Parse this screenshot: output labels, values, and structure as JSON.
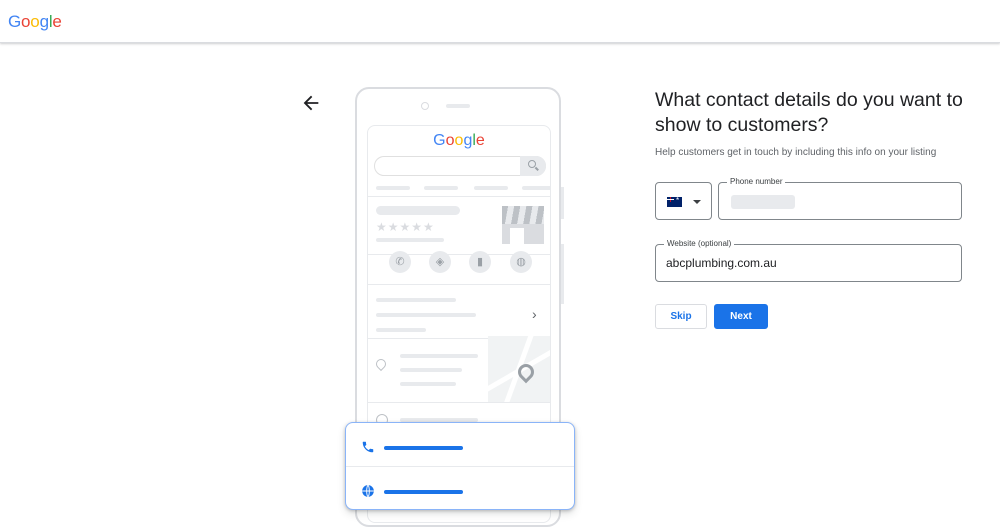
{
  "header": {
    "logo_text": "Google",
    "logo_letters": [
      {
        "ch": "G",
        "color": "#4285f4"
      },
      {
        "ch": "o",
        "color": "#ea4335"
      },
      {
        "ch": "o",
        "color": "#fbbc05"
      },
      {
        "ch": "g",
        "color": "#4285f4"
      },
      {
        "ch": "l",
        "color": "#34a853"
      },
      {
        "ch": "e",
        "color": "#ea4335"
      }
    ]
  },
  "illustration": {
    "logo_text": "Google"
  },
  "form": {
    "heading": "What contact details do you want to show to customers?",
    "subtitle": "Help customers get in touch by including this info on your listing",
    "country_flag": "australia-flag",
    "phone_label": "Phone number",
    "phone_value": "",
    "website_label": "Website (optional)",
    "website_value": "abcplumbing.com.au",
    "skip_label": "Skip",
    "next_label": "Next"
  },
  "colors": {
    "accent": "#1a73e8",
    "border": "#80868b",
    "muted": "#e8eaed"
  }
}
